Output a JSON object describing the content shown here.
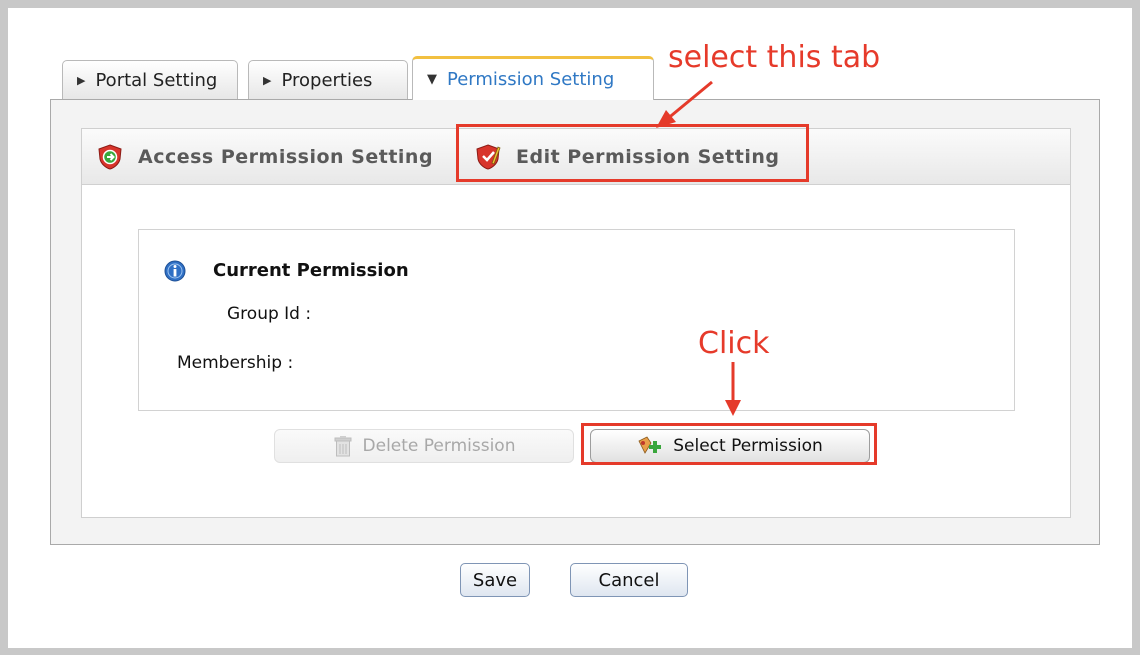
{
  "tabs": [
    {
      "label": "Portal Setting",
      "active": false
    },
    {
      "label": "Properties",
      "active": false
    },
    {
      "label": "Permission Setting",
      "active": true
    }
  ],
  "subtabs": {
    "access_label": "Access Permission Setting",
    "edit_label": "Edit Permission Setting"
  },
  "permission": {
    "title": "Current Permission",
    "group_id_label": "Group Id :",
    "membership_label": "Membership :"
  },
  "actions": {
    "delete_label": "Delete Permission",
    "select_label": "Select Permission"
  },
  "footer": {
    "save_label": "Save",
    "cancel_label": "Cancel"
  },
  "annotations": {
    "select_tab_note": "select this tab",
    "click_note": "Click"
  },
  "colors": {
    "accent_blue": "#2f78c4",
    "active_tab_border": "#f2c040",
    "annotation_red": "#e63a2a",
    "disabled_text": "#a8a8a8"
  },
  "icons": {
    "tab_collapsed": "caret-right-icon",
    "tab_expanded": "caret-down-icon",
    "access": "shield-access-icon",
    "edit": "shield-edit-icon",
    "info": "info-icon",
    "delete": "trash-icon",
    "select": "add-permission-icon"
  }
}
